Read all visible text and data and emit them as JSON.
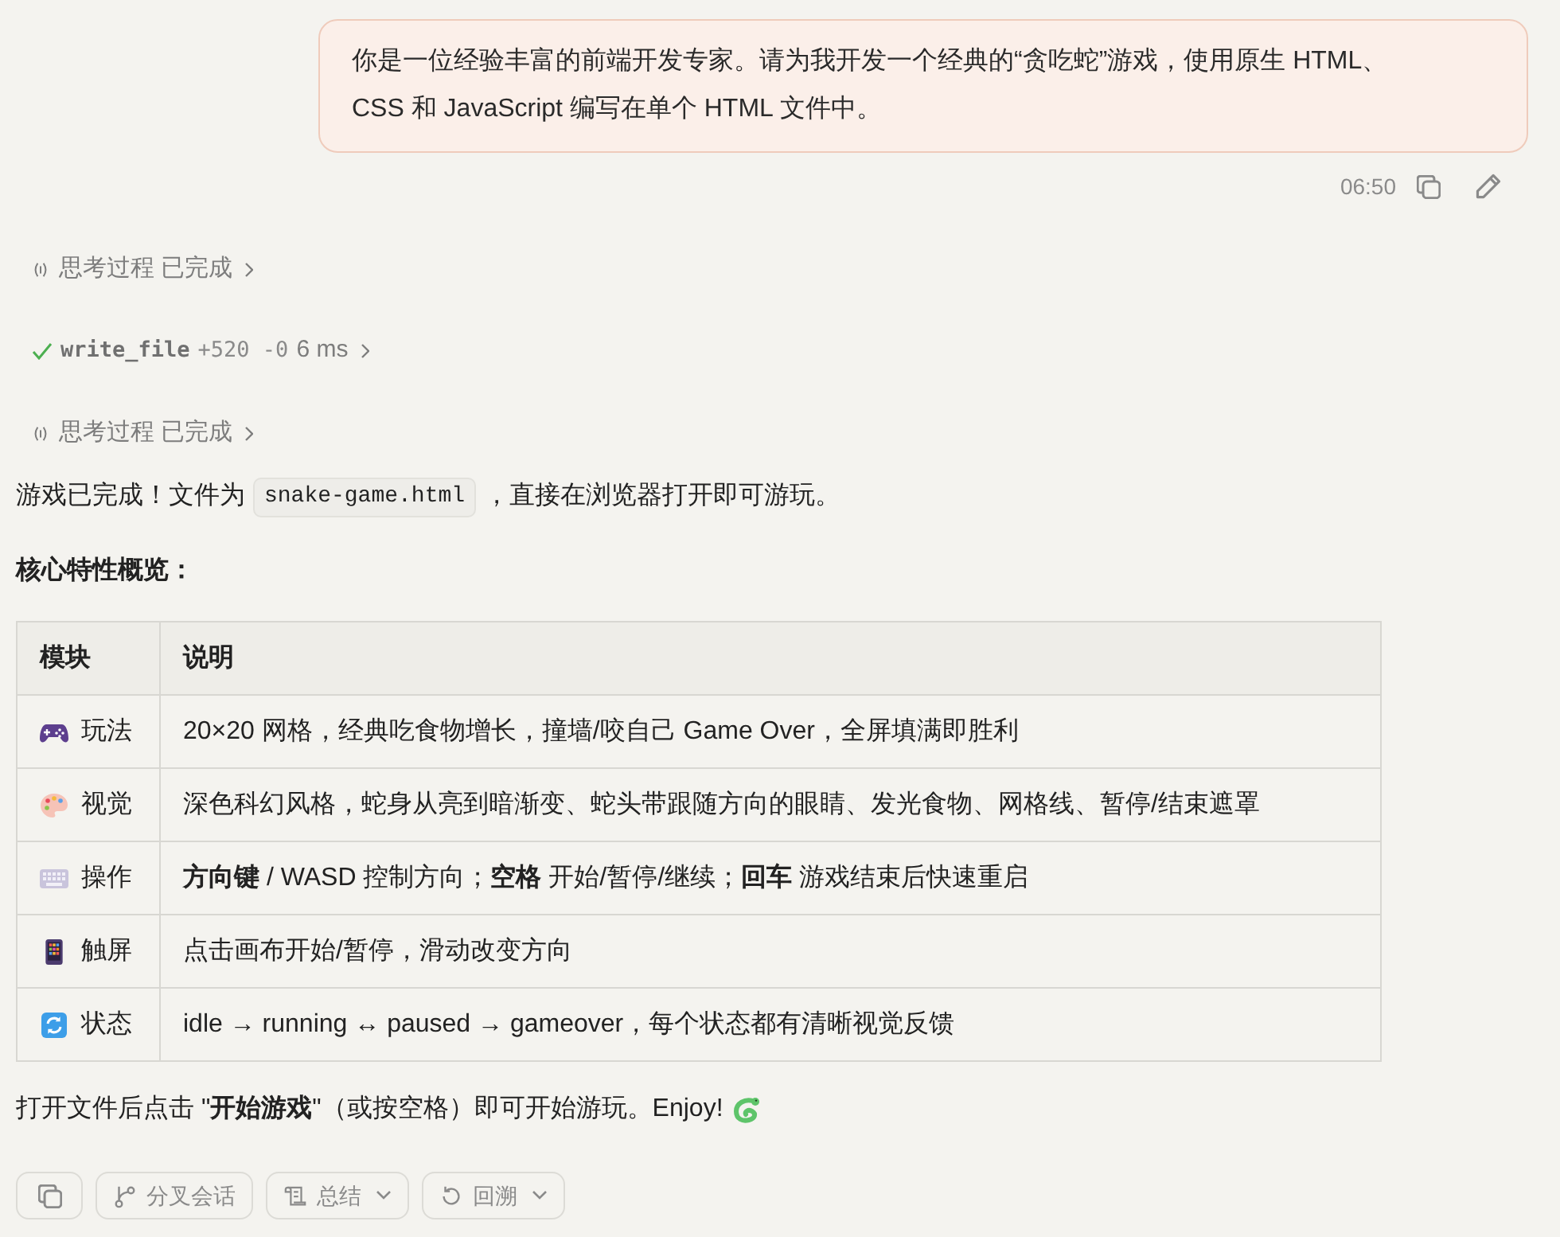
{
  "user_message": {
    "text": "你是一位经验丰富的前端开发专家。请为我开发一个经典的“贪吃蛇”游戏，使用原生 HTML、CSS 和 JavaScript 编写在单个 HTML 文件中。",
    "time": "06:50"
  },
  "steps": [
    {
      "kind": "thinking",
      "label": "思考过程",
      "status": "已完成"
    },
    {
      "kind": "tool",
      "name": "write_file",
      "added": "+520",
      "removed": "-0",
      "duration": "6 ms"
    },
    {
      "kind": "thinking",
      "label": "思考过程",
      "status": "已完成"
    }
  ],
  "reply": {
    "intro": {
      "before": "游戏已完成！文件为",
      "code": "snake-game.html",
      "after": "，直接在浏览器打开即可游玩。"
    },
    "heading": "核心特性概览：",
    "table": {
      "columns": [
        "模块",
        "说明"
      ],
      "rows": [
        {
          "module": "玩法",
          "description": "20×20 网格，经典吃食物增长，撞墙/咬自己 Game Over，全屏填满即胜利"
        },
        {
          "module": "视觉",
          "description": "深色科幻风格，蛇身从亮到暗渐变、蛇头带跟随方向的眼睛、发光食物、网格线、暂停/结束遮罩"
        },
        {
          "module": "操作",
          "description": "**方向键** / WASD 控制方向；**空格** 开始/暂停/继续；**回车** 游戏结束后快速重启"
        },
        {
          "module": "触屏",
          "description": "点击画布开始/暂停，滑动改变方向"
        },
        {
          "module": "状态",
          "description": "idle → running ↔ paused → gameover，每个状态都有清晰视觉反馈"
        }
      ]
    },
    "closing": "打开文件后点击 \"**开始游戏**\"（或按空格）即可开始游玩。Enjoy!"
  },
  "actions": [
    {
      "label": "分叉会话",
      "dropdown": false
    },
    {
      "label": "总结",
      "dropdown": true
    },
    {
      "label": "回溯",
      "dropdown": true
    }
  ]
}
